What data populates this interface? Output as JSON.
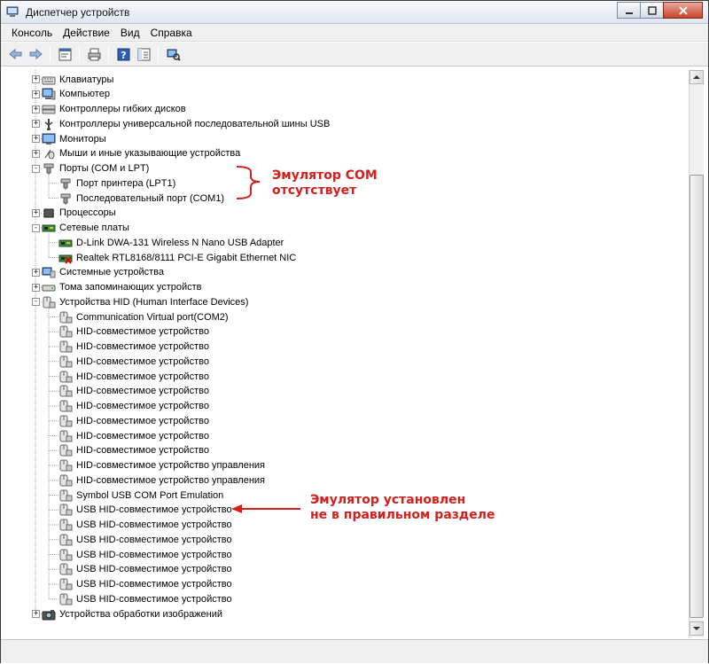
{
  "window": {
    "title": "Диспетчер устройств"
  },
  "menu": [
    "Консоль",
    "Действие",
    "Вид",
    "Справка"
  ],
  "toolbar": [
    {
      "name": "back-arrow-icon"
    },
    {
      "name": "forward-arrow-icon"
    },
    {
      "name": "sep"
    },
    {
      "name": "properties-icon"
    },
    {
      "name": "sep"
    },
    {
      "name": "print-icon"
    },
    {
      "name": "sep"
    },
    {
      "name": "help-icon"
    },
    {
      "name": "console-tree-icon"
    },
    {
      "name": "sep"
    },
    {
      "name": "scan-hardware-icon"
    }
  ],
  "tree": [
    {
      "label": "Клавиатуры",
      "level": 0,
      "expand": "+",
      "icon": "keyboard-icon"
    },
    {
      "label": "Компьютер",
      "level": 0,
      "expand": "+",
      "icon": "computer-icon"
    },
    {
      "label": "Контроллеры гибких дисков",
      "level": 0,
      "expand": "+",
      "icon": "floppy-controller-icon"
    },
    {
      "label": "Контроллеры универсальной последовательной шины USB",
      "level": 0,
      "expand": "+",
      "icon": "usb-controller-icon"
    },
    {
      "label": "Мониторы",
      "level": 0,
      "expand": "+",
      "icon": "monitor-icon"
    },
    {
      "label": "Мыши и иные указывающие устройства",
      "level": 0,
      "expand": "+",
      "icon": "mouse-icon"
    },
    {
      "label": "Порты (COM и LPT)",
      "level": 0,
      "expand": "-",
      "icon": "port-icon"
    },
    {
      "label": "Порт принтера (LPT1)",
      "level": 1,
      "icon": "port-icon"
    },
    {
      "label": "Последовательный порт (COM1)",
      "level": 1,
      "icon": "port-icon"
    },
    {
      "label": "Процессоры",
      "level": 0,
      "expand": "+",
      "icon": "processor-icon"
    },
    {
      "label": "Сетевые платы",
      "level": 0,
      "expand": "-",
      "icon": "network-adapter-icon"
    },
    {
      "label": "D-Link DWA-131 Wireless N Nano USB Adapter",
      "level": 1,
      "icon": "network-adapter-icon"
    },
    {
      "label": "Realtek RTL8168/8111 PCI-E Gigabit Ethernet NIC",
      "level": 1,
      "icon": "network-adapter-disabled-icon"
    },
    {
      "label": "Системные устройства",
      "level": 0,
      "expand": "+",
      "icon": "system-device-icon"
    },
    {
      "label": "Тома запоминающих устройств",
      "level": 0,
      "expand": "+",
      "icon": "storage-volume-icon"
    },
    {
      "label": "Устройства HID (Human Interface Devices)",
      "level": 0,
      "expand": "-",
      "icon": "hid-icon"
    },
    {
      "label": "Communication Virtual port(COM2)",
      "level": 1,
      "icon": "hid-icon"
    },
    {
      "label": "HID-совместимое устройство",
      "level": 1,
      "icon": "hid-icon"
    },
    {
      "label": "HID-совместимое устройство",
      "level": 1,
      "icon": "hid-icon"
    },
    {
      "label": "HID-совместимое устройство",
      "level": 1,
      "icon": "hid-icon"
    },
    {
      "label": "HID-совместимое устройство",
      "level": 1,
      "icon": "hid-icon"
    },
    {
      "label": "HID-совместимое устройство",
      "level": 1,
      "icon": "hid-icon"
    },
    {
      "label": "HID-совместимое устройство",
      "level": 1,
      "icon": "hid-icon"
    },
    {
      "label": "HID-совместимое устройство",
      "level": 1,
      "icon": "hid-icon"
    },
    {
      "label": "HID-совместимое устройство",
      "level": 1,
      "icon": "hid-icon"
    },
    {
      "label": "HID-совместимое устройство",
      "level": 1,
      "icon": "hid-icon"
    },
    {
      "label": "HID-совместимое устройство управления",
      "level": 1,
      "icon": "hid-icon"
    },
    {
      "label": "HID-совместимое устройство управления",
      "level": 1,
      "icon": "hid-icon"
    },
    {
      "label": "Symbol USB COM Port Emulation",
      "level": 1,
      "icon": "hid-icon"
    },
    {
      "label": "USB HID-совместимое устройство",
      "level": 1,
      "icon": "hid-icon"
    },
    {
      "label": "USB HID-совместимое устройство",
      "level": 1,
      "icon": "hid-icon"
    },
    {
      "label": "USB HID-совместимое устройство",
      "level": 1,
      "icon": "hid-icon"
    },
    {
      "label": "USB HID-совместимое устройство",
      "level": 1,
      "icon": "hid-icon"
    },
    {
      "label": "USB HID-совместимое устройство",
      "level": 1,
      "icon": "hid-icon"
    },
    {
      "label": "USB HID-совместимое устройство",
      "level": 1,
      "icon": "hid-icon"
    },
    {
      "label": "USB HID-совместимое устройство",
      "level": 1,
      "icon": "hid-icon"
    },
    {
      "label": "Устройства обработки изображений",
      "level": 0,
      "expand": "+",
      "icon": "imaging-device-icon"
    }
  ],
  "annotations": {
    "com_missing": [
      "Эмулятор COM",
      "отсутствует"
    ],
    "wrong_section": [
      "Эмулятор установлен",
      "не в правильном разделе"
    ],
    "color": "#d3201c"
  }
}
